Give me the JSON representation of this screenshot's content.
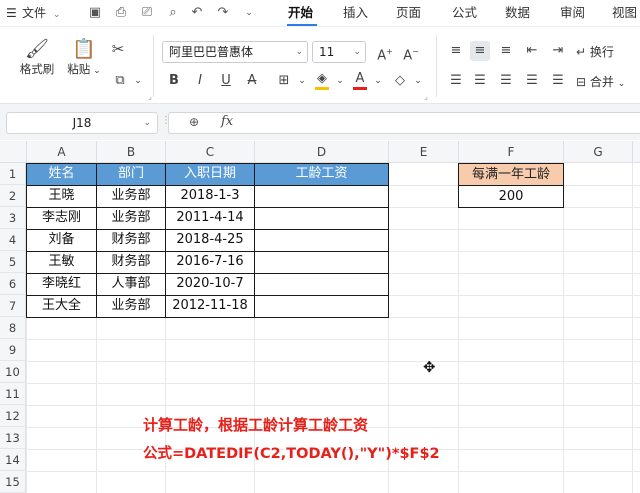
{
  "menubar": {
    "file_label": "文件",
    "tabs": [
      "开始",
      "插入",
      "页面",
      "公式",
      "数据",
      "审阅",
      "视图"
    ],
    "active_tab_index": 0
  },
  "ribbon": {
    "format_painter": "格式刷",
    "paste": "粘贴",
    "font_name": "阿里巴巴普惠体",
    "font_size": "11",
    "wrap_text": "换行",
    "merge": "合并"
  },
  "formula_bar": {
    "cell_ref": "J18",
    "fx_label": "fx",
    "formula": ""
  },
  "sheet": {
    "columns": [
      "A",
      "B",
      "C",
      "D",
      "E",
      "F",
      "G"
    ],
    "rows": [
      "1",
      "2",
      "3",
      "4",
      "5",
      "6",
      "7",
      "8",
      "9",
      "10",
      "11",
      "12",
      "13",
      "14",
      "15"
    ],
    "table_headers": [
      "姓名",
      "部门",
      "入职日期",
      "工龄工资"
    ],
    "table_rows": [
      [
        "王晓",
        "业务部",
        "2018-1-3",
        ""
      ],
      [
        "李志刚",
        "业务部",
        "2011-4-14",
        ""
      ],
      [
        "刘备",
        "财务部",
        "2018-4-25",
        ""
      ],
      [
        "王敏",
        "财务部",
        "2016-7-16",
        ""
      ],
      [
        "李晓红",
        "人事部",
        "2020-10-7",
        ""
      ],
      [
        "王大全",
        "业务部",
        "2012-11-18",
        ""
      ]
    ],
    "rate_header": "每满一年工龄",
    "rate_value": "200"
  },
  "annotation": {
    "line1": "计算工龄，根据工龄计算工龄工资",
    "line2": "公式=DATEDIF(C2,TODAY(),\"Y\")*$F$2"
  },
  "colors": {
    "header_blue": "#5b9bd5",
    "header_orange": "#f8cbad",
    "annotation_red": "#e8201a",
    "active_tab_blue": "#2b7de9"
  }
}
